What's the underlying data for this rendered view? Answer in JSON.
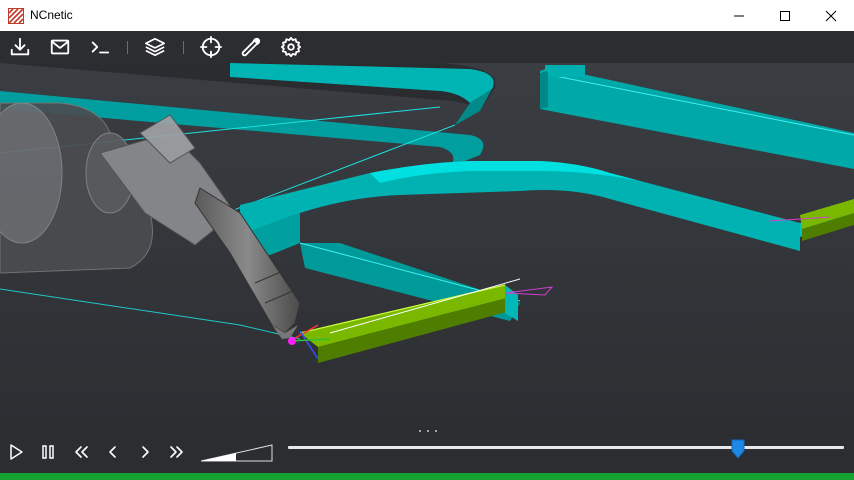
{
  "window": {
    "title": "NCnetic",
    "minimize_icon": "minimize-icon",
    "maximize_icon": "maximize-icon",
    "close_icon": "close-icon"
  },
  "toolbar": {
    "items": [
      "download-icon",
      "mail-icon",
      "terminal-icon",
      "layers-icon",
      "crosshair-icon",
      "wrench-icon",
      "gear-icon"
    ]
  },
  "playback": {
    "controls": [
      "play-icon",
      "pause-icon",
      "rewind-icon",
      "step-back-icon",
      "step-forward-icon",
      "fast-forward-icon"
    ],
    "progress_fraction": 0.81
  },
  "colors": {
    "toolbar_bg": "#2b2d30",
    "viewport_bg": "#2f3135",
    "part_cyan": "#00c8c8",
    "toolpath_green": "#7ab800",
    "status_green": "#17a331",
    "slider_thumb": "#1e88e5"
  }
}
